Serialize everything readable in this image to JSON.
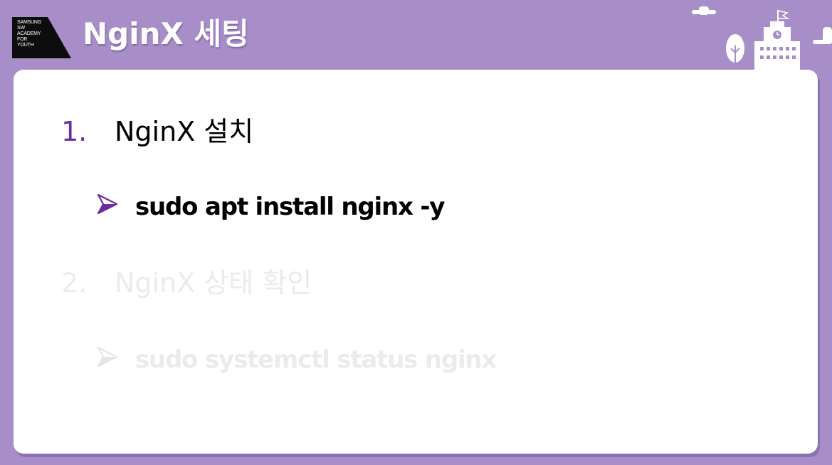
{
  "header": {
    "title": "NginX 세팅",
    "logo_lines": [
      "SAMSUNG",
      "SW",
      "ACADEMY",
      "FOR",
      "YOUTH"
    ]
  },
  "decoration": {
    "icons": [
      "cloud-icon",
      "tree-icon",
      "school-building-icon",
      "clock-icon",
      "flag-icon"
    ]
  },
  "slide": {
    "items": [
      {
        "number": "1.",
        "title": "NginX 설치",
        "command": "sudo apt install nginx -y",
        "state": "active"
      },
      {
        "number": "2.",
        "title": "NginX 상태 확인",
        "command": "sudo systemctl status nginx",
        "state": "dimmed"
      }
    ]
  },
  "colors": {
    "background": "#a78ec8",
    "accent": "#6a2c9e",
    "active_text": "#000000",
    "dimmed_text": "#ebebeb",
    "card": "#ffffff"
  }
}
